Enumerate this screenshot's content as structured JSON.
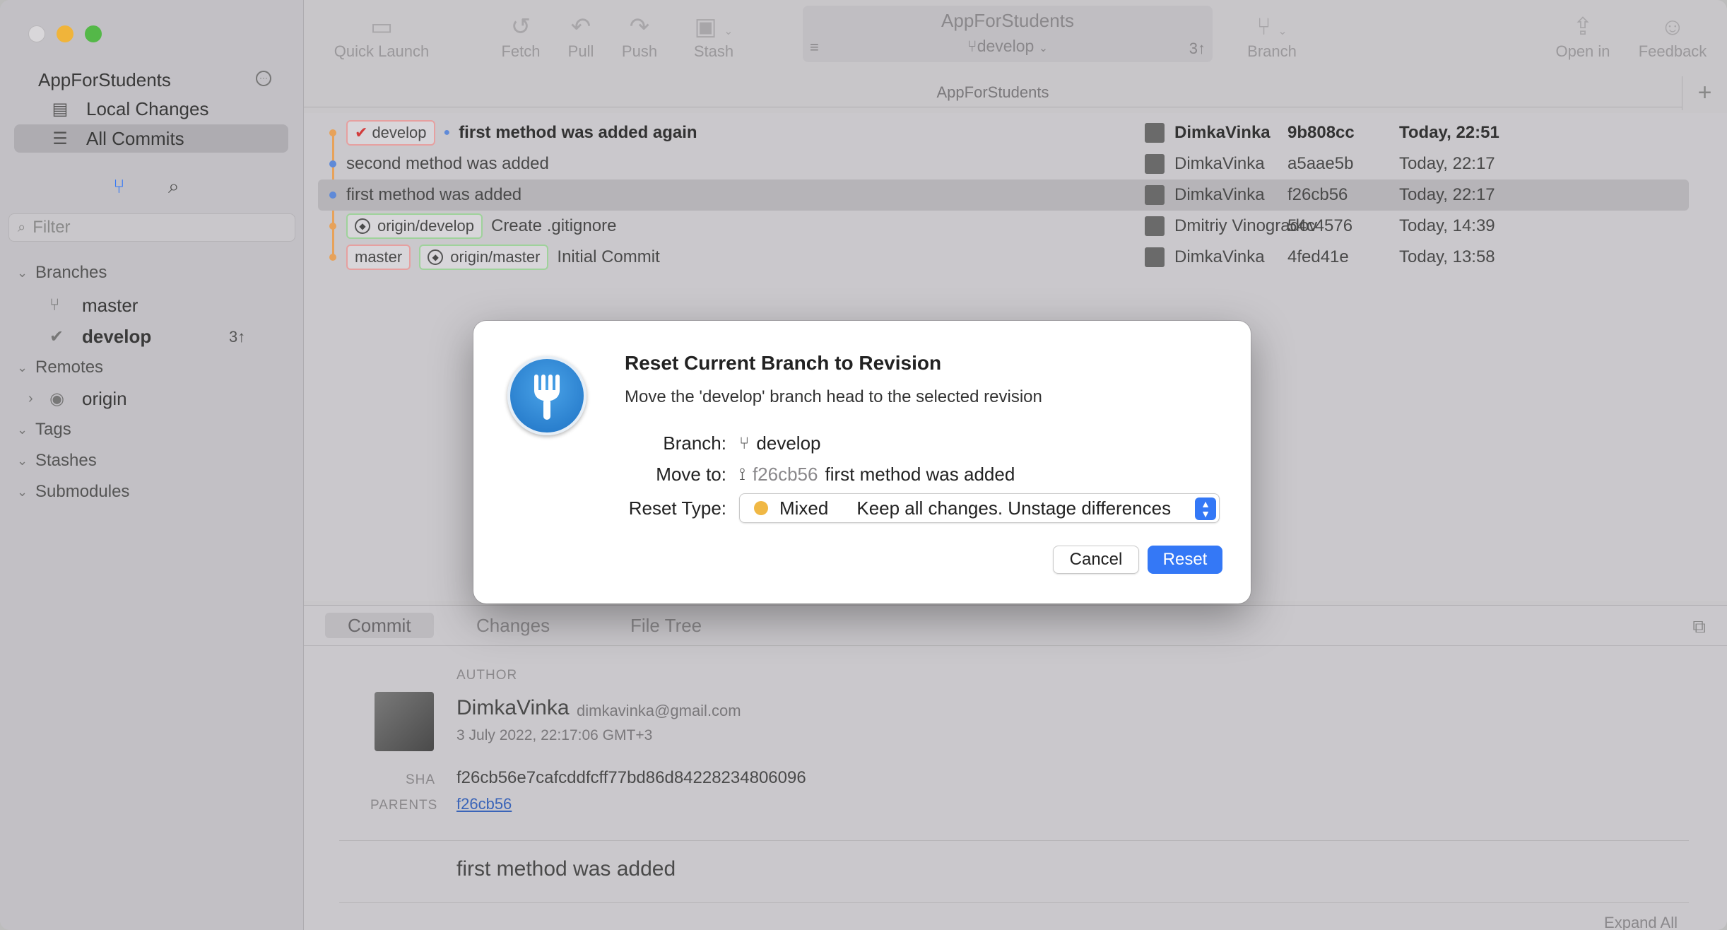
{
  "sidebar": {
    "repo_title": "AppForStudents",
    "nav": [
      {
        "label": "Local Changes",
        "icon": "document-icon"
      },
      {
        "label": "All Commits",
        "icon": "stack-icon"
      }
    ],
    "filter_placeholder": "Filter",
    "sections": {
      "branches": "Branches",
      "remotes": "Remotes",
      "tags": "Tags",
      "stashes": "Stashes",
      "submodules": "Submodules"
    },
    "branches": [
      {
        "name": "master",
        "ahead": ""
      },
      {
        "name": "develop",
        "ahead": "3↑"
      }
    ],
    "remotes": [
      {
        "name": "origin"
      }
    ]
  },
  "toolbar": {
    "quick_launch": "Quick Launch",
    "fetch": "Fetch",
    "pull": "Pull",
    "push": "Push",
    "stash": "Stash",
    "repo_name": "AppForStudents",
    "repo_branch": "develop",
    "repo_ahead": "3↑",
    "branch": "Branch",
    "open_in": "Open in",
    "feedback": "Feedback"
  },
  "tab_title": "AppForStudents",
  "commits": [
    {
      "tags": [
        "develop"
      ],
      "message": "first method was added again",
      "author": "DimkaVinka",
      "sha": "9b808cc",
      "date": "Today, 22:51"
    },
    {
      "tags": [],
      "message": "second method was added",
      "author": "DimkaVinka",
      "sha": "a5aae5b",
      "date": "Today, 22:17"
    },
    {
      "tags": [],
      "message": "first method was added",
      "author": "DimkaVinka",
      "sha": "f26cb56",
      "date": "Today, 22:17"
    },
    {
      "tags": [
        "origin/develop"
      ],
      "message": "Create .gitignore",
      "author": "Dmitriy Vinogradov",
      "sha": "54c4576",
      "date": "Today, 14:39"
    },
    {
      "tags": [
        "master",
        "origin/master"
      ],
      "message": "Initial Commit",
      "author": "DimkaVinka",
      "sha": "4fed41e",
      "date": "Today, 13:58"
    }
  ],
  "detail": {
    "tabs": [
      "Commit",
      "Changes",
      "File Tree"
    ],
    "author_label": "AUTHOR",
    "author_name": "DimkaVinka",
    "author_email": "dimkavinka@gmail.com",
    "author_date": "3 July 2022, 22:17:06 GMT+3",
    "sha_label": "SHA",
    "sha": "f26cb56e7cafcddfcff77bd86d84228234806096",
    "parents_label": "PARENTS",
    "parent": "f26cb56",
    "message": "first method was added",
    "expand_all": "Expand All"
  },
  "dialog": {
    "title": "Reset Current Branch to Revision",
    "subtitle": "Move the 'develop' branch head to the selected revision",
    "branch_label": "Branch:",
    "branch_value": "develop",
    "move_to_label": "Move to:",
    "move_to_sha": "f26cb56",
    "move_to_message": "first method was added",
    "reset_type_label": "Reset Type:",
    "reset_type_mode": "Mixed",
    "reset_type_desc": "Keep all changes. Unstage differences",
    "cancel": "Cancel",
    "reset": "Reset",
    "accent": "#3478f6"
  }
}
